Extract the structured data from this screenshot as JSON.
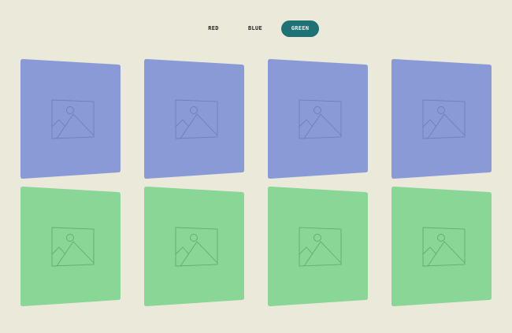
{
  "filters": {
    "items": [
      {
        "key": "red",
        "label": "RED",
        "active": false
      },
      {
        "key": "blue",
        "label": "BLUE",
        "active": false
      },
      {
        "key": "green",
        "label": "GREEN",
        "active": true
      }
    ]
  },
  "colors": {
    "background": "#ebe9da",
    "active_filter": "#1e7276",
    "blue_card": "#8a9ad7",
    "green_card": "#8ad697",
    "placeholder_stroke_blue": "#6f7fbd",
    "placeholder_stroke_green": "#5faf6d"
  },
  "gallery": {
    "rows": [
      {
        "color_key": "blue",
        "cards": [
          {
            "icon": "image-placeholder-icon"
          },
          {
            "icon": "image-placeholder-icon"
          },
          {
            "icon": "image-placeholder-icon"
          },
          {
            "icon": "image-placeholder-icon"
          }
        ]
      },
      {
        "color_key": "green",
        "cards": [
          {
            "icon": "image-placeholder-icon"
          },
          {
            "icon": "image-placeholder-icon"
          },
          {
            "icon": "image-placeholder-icon"
          },
          {
            "icon": "image-placeholder-icon"
          }
        ]
      }
    ]
  }
}
